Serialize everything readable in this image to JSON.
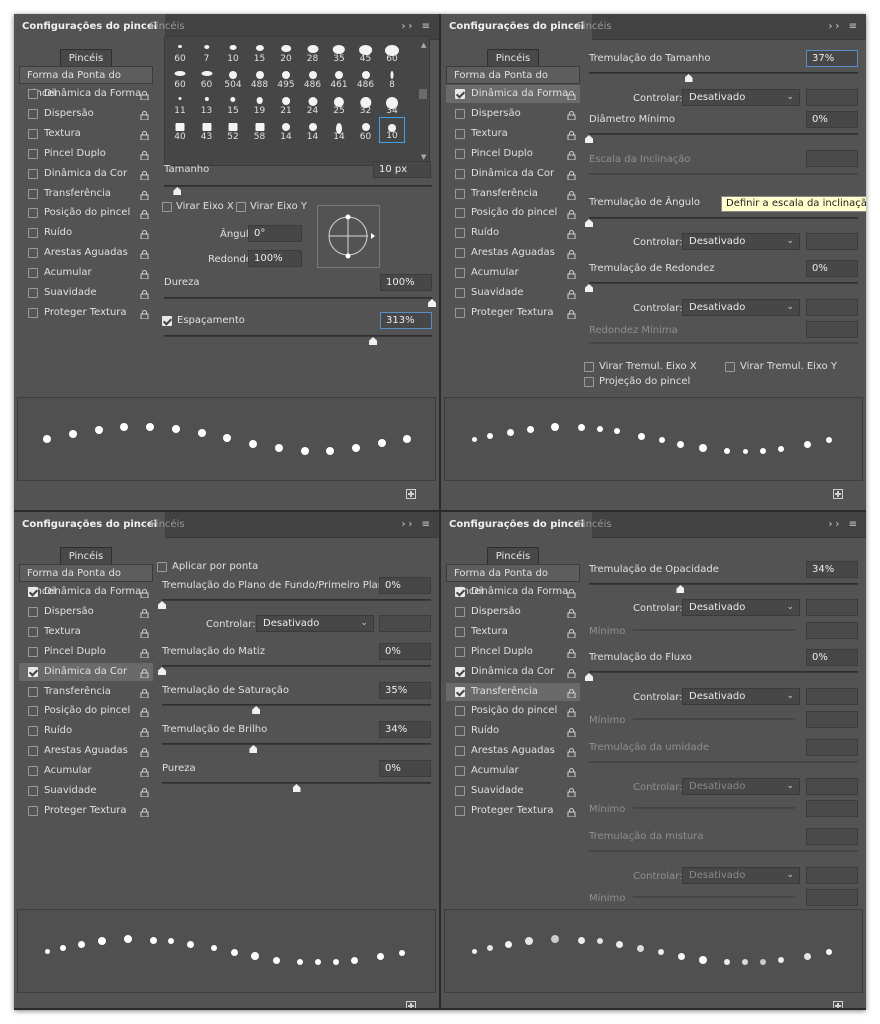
{
  "panel_title": "Configurações do pincel",
  "brushes_tab": "Pincéis",
  "pinceis_button": "Pincéis",
  "tip_shape_label": "Forma da Ponta do Pincel",
  "side_items": [
    "Dinâmica da Forma",
    "Dispersão",
    "Textura",
    "Pincel Duplo",
    "Dinâmica da Cor",
    "Transferência",
    "Posição do pincel",
    "Ruído",
    "Arestas Aguadas",
    "Acumular",
    "Suavidade",
    "Proteger Textura"
  ],
  "checked": {
    "p1": [],
    "p2": [
      0
    ],
    "p3": [
      0,
      4
    ],
    "p4": [
      0,
      4,
      5
    ]
  },
  "highlight": {
    "p1": -1,
    "p2": 0,
    "p3": 4,
    "p4": 5
  },
  "p1": {
    "brush_sizes": [
      "60",
      "7",
      "10",
      "15",
      "20",
      "28",
      "35",
      "45",
      "60",
      "60",
      "60",
      "504",
      "488",
      "495",
      "486",
      "461",
      "486",
      "8",
      "11",
      "13",
      "15",
      "19",
      "21",
      "24",
      "25",
      "32",
      "34",
      "40",
      "43",
      "52",
      "58",
      "14",
      "14",
      "14",
      "60",
      "10"
    ],
    "size_label": "Tamanho",
    "size_value": "10 px",
    "flip_x": "Virar Eixo X",
    "flip_y": "Virar Eixo Y",
    "angle_label": "Ângulo:",
    "angle_value": "0°",
    "roundness_label": "Redondez:",
    "roundness_value": "100%",
    "hardness_label": "Dureza",
    "hardness_value": "100%",
    "hardness_level": 1.0,
    "spacing_label": "Espaçamento",
    "spacing_value": "313%",
    "spacing_level": 0.78,
    "size_level": 0.05
  },
  "p2": {
    "size_jitter_label": "Tremulação do Tamanho",
    "size_jitter_value": "37%",
    "size_jitter_level": 0.37,
    "control_label": "Controlar:",
    "control_value": "Desativado",
    "min_diam_label": "Diâmetro Mínimo",
    "min_diam_value": "0%",
    "tilt_label": "Escala da Inclinação",
    "angle_jitter_label": "Tremulação de Ângulo",
    "tooltip": "Definir a escala da inclinação d",
    "round_jitter_label": "Tremulação de Redondez",
    "round_jitter_value": "0%",
    "min_round_label": "Redondez Mínima",
    "flip_x_jitter": "Virar Tremul. Eixo X",
    "flip_y_jitter": "Virar Tremul. Eixo Y",
    "projection": "Projeção do pincel"
  },
  "p3": {
    "apply_per_tip": "Aplicar por ponta",
    "fg_bg_label": "Tremulação do Plano de Fundo/Primeiro Plano",
    "fg_bg_value": "0%",
    "control_label": "Controlar:",
    "control_value": "Desativado",
    "hue_label": "Tremulação do Matiz",
    "hue_value": "0%",
    "sat_label": "Tremulação de Saturação",
    "sat_value": "35%",
    "sat_level": 0.35,
    "bright_label": "Tremulação de Brilho",
    "bright_value": "34%",
    "bright_level": 0.34,
    "purity_label": "Pureza",
    "purity_value": "0%",
    "purity_level": 0.5
  },
  "p4": {
    "opacity_label": "Tremulação de Opacidade",
    "opacity_value": "34%",
    "opacity_level": 0.34,
    "control_label": "Controlar:",
    "control_value": "Desativado",
    "min_label": "Mínimo",
    "flow_label": "Tremulação do Fluxo",
    "flow_value": "0%",
    "wet_label": "Tremulação da umidade",
    "mix_label": "Tremulação da mistura"
  }
}
